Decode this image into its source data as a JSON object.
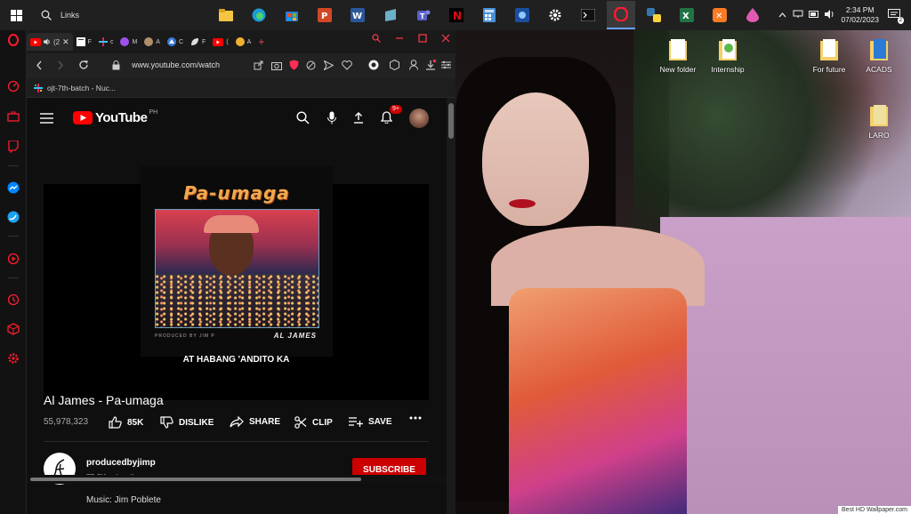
{
  "taskbar": {
    "search_label": "Links",
    "clock_time": "2:34 PM",
    "clock_date": "07/02/2023",
    "notification_count": "2"
  },
  "desktop": {
    "icons": [
      {
        "label": "New folder"
      },
      {
        "label": "Internship"
      },
      {
        "label": "For future"
      },
      {
        "label": "ACADS"
      },
      {
        "label": "LARO"
      }
    ],
    "watermark": "Best HD Wallpaper.com"
  },
  "browser": {
    "active_tab_label": "(2",
    "url": "www.youtube.com/watch",
    "bookmark_label": "ojt-7th-batch - Nuc..."
  },
  "youtube": {
    "logo_text": "YouTube",
    "region": "PH",
    "notification_badge": "9+",
    "album_title": "Pa-umaga",
    "album_credit": "PRODUCED BY JIM P",
    "album_artist": "AL JAMES",
    "caption": "AT HABANG 'ANDITO KA",
    "video_title": "Al James - Pa-umaga",
    "views": "55,978,323",
    "like_count": "85K",
    "dislike_label": "DISLIKE",
    "share_label": "SHARE",
    "clip_label": "CLIP",
    "save_label": "SAVE",
    "channel_name": "producedbyjimp",
    "subscribers": "75.2K subscribers",
    "subscribe_label": "SUBSCRIBE",
    "description_first_line": "Music: Jim Poblete"
  },
  "colors": {
    "accent_red": "#cc0000",
    "opera_red": "#ff1b2d",
    "bg": "#0f0f0f"
  }
}
